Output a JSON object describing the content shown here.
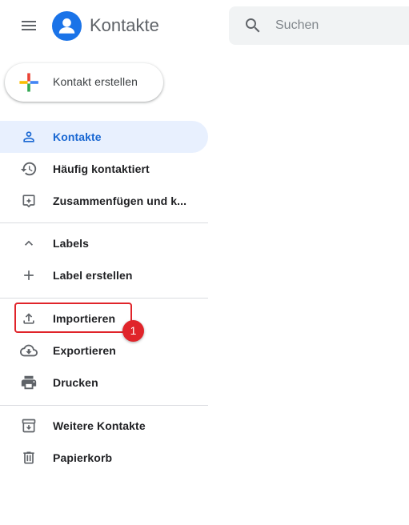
{
  "header": {
    "app_title": "Kontakte",
    "search_placeholder": "Suchen",
    "menu_icon": "hamburger-menu-icon",
    "logo_icon": "contacts-logo-icon"
  },
  "create_button": {
    "label": "Kontakt erstellen"
  },
  "nav": {
    "main": [
      {
        "label": "Kontakte",
        "icon": "person-icon",
        "active": true
      },
      {
        "label": "Häufig kontaktiert",
        "icon": "history-icon"
      },
      {
        "label": "Zusammenfügen und k...",
        "icon": "merge-icon"
      }
    ],
    "labels": [
      {
        "label": "Labels",
        "icon": "chevron-up-icon"
      },
      {
        "label": "Label erstellen",
        "icon": "plus-icon"
      }
    ],
    "tools": [
      {
        "label": "Importieren",
        "icon": "upload-icon"
      },
      {
        "label": "Exportieren",
        "icon": "cloud-download-icon"
      },
      {
        "label": "Drucken",
        "icon": "print-icon"
      }
    ],
    "other": [
      {
        "label": "Weitere Kontakte",
        "icon": "archive-icon"
      },
      {
        "label": "Papierkorb",
        "icon": "trash-icon"
      }
    ]
  },
  "annotation": {
    "step_number": "1",
    "color": "#e0242a"
  },
  "colors": {
    "accent": "#1967d2",
    "active_bg": "#e8f0fe",
    "logo_blue": "#1a73e8"
  }
}
